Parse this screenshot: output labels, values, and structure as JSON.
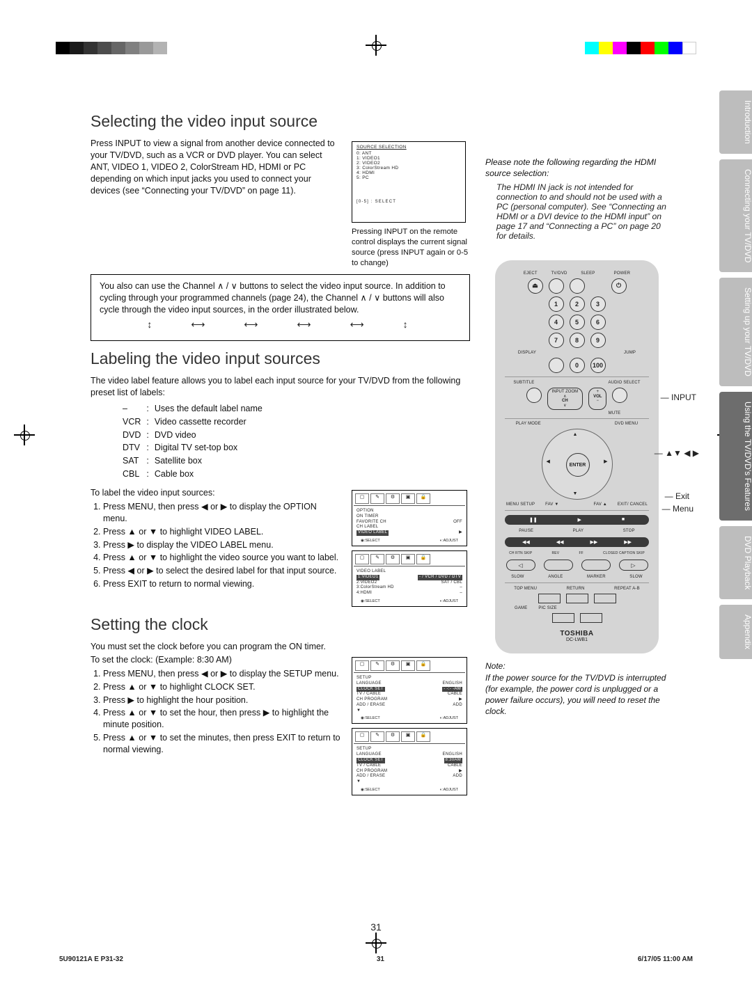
{
  "section1": {
    "heading": "Selecting the video input source",
    "body": "Press INPUT to view a signal from another device connected to your TV/DVD, such as a VCR or DVD player. You can select ANT, VIDEO 1, VIDEO 2, ColorStream HD, HDMI or PC depending on which input jacks you used to connect your devices (see “Connecting your TV/DVD” on page 11).",
    "sourceBox": {
      "title": "SOURCE SELECTION",
      "items": [
        "0: ANT",
        "1: VIDEO1",
        "2: VIDEO2",
        "3: ColorStream HD",
        "4: HDMI",
        "5: PC"
      ],
      "hint": "[0-5] : SELECT"
    },
    "caption": "Pressing INPUT on the remote control displays the current signal source (press INPUT again or 0-5 to change)",
    "note": "You also can use the Channel ∧ / ∨ buttons to select the video input source. In addition to cycling through your programmed channels (page 24), the Channel ∧ / ∨ buttons will also cycle through the video input sources, in the order illustrated below."
  },
  "section2": {
    "heading": "Labeling the video input sources",
    "intro": "The video label feature allows you to label each input source for your TV/DVD from the following preset list of labels:",
    "labels": [
      {
        "k": "–",
        "v": "Uses the default label name"
      },
      {
        "k": "VCR",
        "v": "Video cassette recorder"
      },
      {
        "k": "DVD",
        "v": "DVD video"
      },
      {
        "k": "DTV",
        "v": "Digital TV set-top box"
      },
      {
        "k": "SAT",
        "v": "Satellite box"
      },
      {
        "k": "CBL",
        "v": "Cable box"
      }
    ],
    "lead": "To label the video input sources:",
    "steps": [
      "Press MENU, then press ◀ or ▶ to display the OPTION menu.",
      "Press ▲ or ▼ to highlight VIDEO LABEL.",
      "Press ▶ to display the VIDEO LABEL menu.",
      "Press ▲ or ▼ to highlight the video source you want to label.",
      "Press  ◀ or ▶  to select the desired label for that input source.",
      "Press EXIT to return to normal viewing."
    ],
    "menu1": {
      "title": "OPTION",
      "rows": [
        [
          "ON TIMER",
          ""
        ],
        [
          "FAVORITE CH",
          "OFF"
        ],
        [
          "CH LABEL",
          ""
        ],
        [
          "VIDEO LABEL",
          "▶"
        ]
      ],
      "sel": "SELECT",
      "adj": "ADJUST"
    },
    "menu2": {
      "title": "VIDEO LABEL",
      "rows": [
        [
          "1:VIDEO1",
          "- / VCR / DVD / DTV"
        ],
        [
          "2:VIDEO2",
          "SAT / CBL"
        ],
        [
          "3:ColorStream HD",
          "–"
        ],
        [
          "4:HDMI",
          "–"
        ]
      ],
      "sel": "SELECT",
      "adj": "ADJUST"
    }
  },
  "section3": {
    "heading": "Setting the clock",
    "intro": "You must set the clock before you can program the ON timer.",
    "lead": "To set the clock: (Example: 8:30 AM)",
    "steps": [
      "Press MENU, then press ◀ or ▶ to display the SETUP menu.",
      "Press ▲ or ▼ to highlight CLOCK SET.",
      "Press ▶ to highlight the hour position.",
      "Press ▲ or ▼ to set the hour, then press ▶ to highlight the minute position.",
      "Press ▲ or ▼ to set the minutes, then press EXIT to return to normal viewing."
    ],
    "menu1": {
      "title": "SETUP",
      "rows": [
        [
          "LANGUAGE",
          "ENGLISH"
        ],
        [
          "CLOCK SET",
          "  - -:- -AM"
        ],
        [
          "TV / CABLE",
          "CABLE"
        ],
        [
          "CH PROGRAM",
          "▶"
        ],
        [
          "ADD / ERASE",
          "ADD"
        ],
        [
          "▼",
          ""
        ]
      ],
      "sel": "SELECT",
      "adj": "ADJUST"
    },
    "menu2": {
      "title": "SETUP",
      "rows": [
        [
          "LANGUAGE",
          "ENGLISH"
        ],
        [
          "CLOCK SET",
          "  8:30AM"
        ],
        [
          "TV / CABLE",
          "CABLE"
        ],
        [
          "CH PROGRAM",
          "▶"
        ],
        [
          "ADD / ERASE",
          "ADD"
        ],
        [
          "▼",
          ""
        ]
      ],
      "sel": "SELECT",
      "adj": "ADJUST"
    }
  },
  "hdmi": {
    "lead": "Please note the following regarding the HDMI source selection:",
    "body": "The HDMI IN jack is not intended for connection to and should not be used with a PC (personal computer). See “Connecting an HDMI or a DVI device to the HDMI input” on page 17 and “Connecting a PC” on page 20 for details."
  },
  "note2": {
    "head": "Note:",
    "body": "If the power source for the TV/DVD is interrupted (for  example, the power cord is unplugged or a power failure occurs), you will need to reset the clock."
  },
  "remote": {
    "topLabels": [
      "EJECT",
      "TV/DVD",
      "SLEEP",
      "POWER"
    ],
    "nums": [
      "1",
      "2",
      "3",
      "4",
      "5",
      "6",
      "7",
      "8",
      "9",
      "0",
      "100"
    ],
    "row2l": "DISPLAY",
    "row2r": "JUMP",
    "row3": [
      "SUBTITLE",
      "",
      "",
      "AUDIO SELECT"
    ],
    "rocker": [
      "INPUT\nZOOM",
      "CH",
      "VOL",
      "MUTE"
    ],
    "row4": [
      "PLAY MODE",
      "DVD MENU"
    ],
    "dpad": {
      "center": "ENTER",
      "left": "FAV\n▼",
      "right": "FAV\n▲",
      "tl": "MENU\nSETUP",
      "tr": "EXIT/\nCANCEL"
    },
    "row5": [
      "PAUSE",
      "PLAY",
      "STOP"
    ],
    "row6": [
      "CH RTN\nSKIP",
      "REV",
      "FF",
      "CLOSED CAPTION\nSKIP"
    ],
    "row7": [
      "SLOW",
      "ANGLE",
      "MARKER",
      "SLOW"
    ],
    "row8": [
      "TOP MENU",
      "RETURN",
      "REPEAT A-B"
    ],
    "row9": [
      "GAME",
      "PIC SIZE"
    ],
    "brand": "TOSHIBA",
    "model": "DC-LWB1"
  },
  "callouts": {
    "a": "INPUT",
    "b": "▲▼ ◀ ▶",
    "c": "Exit",
    "d": "Menu"
  },
  "sideTabs": [
    "Introduction",
    "Connecting your TV/DVD",
    "Setting up your TV/DVD",
    "Using the TV/DVD’s Features",
    "DVD Playback",
    "Appendix"
  ],
  "pageNum": "31",
  "footer": {
    "left": "5U90121A E P31-32",
    "mid": "31",
    "right": "6/17/05  11:00 AM"
  }
}
